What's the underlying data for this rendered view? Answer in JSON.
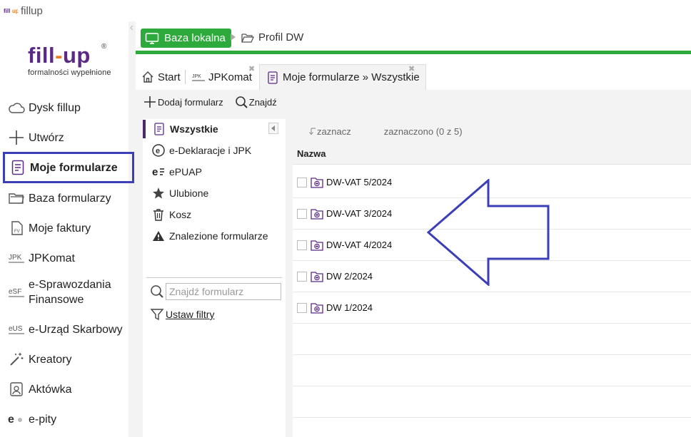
{
  "app": {
    "title": "fillup"
  },
  "logo": {
    "part1": "fill",
    "dash": "-",
    "part2": "up",
    "reg": "®",
    "tagline": "formalności wypełnione"
  },
  "sidebar": {
    "items": [
      {
        "id": "dysk",
        "label": "Dysk fillup",
        "icon": "cloud-icon"
      },
      {
        "id": "utworz",
        "label": "Utwórz",
        "icon": "plus-icon"
      },
      {
        "id": "moje",
        "label": "Moje formularze",
        "icon": "form-icon",
        "active": true
      },
      {
        "id": "baza",
        "label": "Baza formularzy",
        "icon": "folders-icon"
      },
      {
        "id": "faktury",
        "label": "Moje faktury",
        "icon": "invoice-icon"
      },
      {
        "id": "jpk",
        "label": "JPKomat",
        "icon": "jpk-icon"
      },
      {
        "id": "esf",
        "label": "e-Sprawozdania Finansowe",
        "icon": "esf-icon"
      },
      {
        "id": "eus",
        "label": "e-Urząd Skarbowy",
        "icon": "eus-icon"
      },
      {
        "id": "kreatory",
        "label": "Kreatory",
        "icon": "wand-icon"
      },
      {
        "id": "aktowka",
        "label": "Aktówka",
        "icon": "briefcase-icon"
      },
      {
        "id": "epity",
        "label": "e-pity",
        "icon": "epity-icon"
      }
    ]
  },
  "breadcrumb": {
    "local": "Baza lokalna",
    "profile": "Profil DW"
  },
  "tabs": [
    {
      "label": "Start",
      "icon": "home-icon"
    },
    {
      "label": "JPKomat",
      "icon": "jpk-icon",
      "closable": true
    },
    {
      "label": "Moje formularze » Wszystkie",
      "icon": "form-icon",
      "closable": true,
      "active": true
    }
  ],
  "tab_icons": {
    "jpk_text": "JPK"
  },
  "toolbar": {
    "add": "Dodaj formularz",
    "find": "Znajdź"
  },
  "categories": [
    {
      "label": "Wszystkie",
      "icon": "form-icon",
      "active": true
    },
    {
      "label": "e-Deklaracje i JPK",
      "icon": "e-circle-icon"
    },
    {
      "label": "ePUAP",
      "icon": "epuap-icon"
    },
    {
      "label": "Ulubione",
      "icon": "star-icon"
    },
    {
      "label": "Kosz",
      "icon": "trash-icon"
    },
    {
      "label": "Znalezione formularze",
      "icon": "warning-icon"
    }
  ],
  "search": {
    "placeholder": "Znajdź formularz"
  },
  "filters": {
    "label": "Ustaw filtry"
  },
  "list": {
    "mark_label": "zaznacz",
    "selected_label": "zaznaczono (0 z 5)",
    "column": "Nazwa",
    "rows": [
      "DW-VAT 5/2024",
      "DW-VAT 3/2024",
      "DW-VAT 4/2024",
      "DW 2/2024",
      "DW 1/2024"
    ]
  },
  "colors": {
    "accent_green": "#2eaa3c",
    "highlight_blue": "#3a3fb8",
    "brand_purple": "#5b2a86",
    "brand_orange": "#f07a1a"
  }
}
